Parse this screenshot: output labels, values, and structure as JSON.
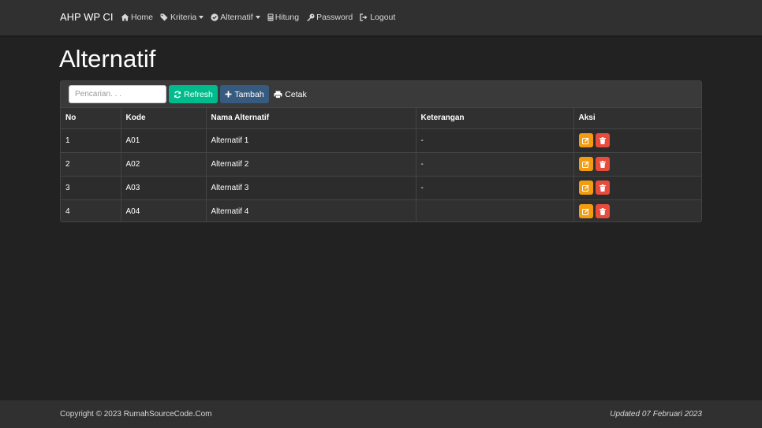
{
  "navbar": {
    "brand": "AHP WP CI",
    "items": [
      {
        "label": "Home",
        "icon": "home-icon",
        "dropdown": false
      },
      {
        "label": "Kriteria",
        "icon": "tags-icon",
        "dropdown": true
      },
      {
        "label": "Alternatif",
        "icon": "check-circle-icon",
        "dropdown": true
      },
      {
        "label": "Hitung",
        "icon": "calculator-icon",
        "dropdown": false
      },
      {
        "label": "Password",
        "icon": "key-icon",
        "dropdown": false
      },
      {
        "label": "Logout",
        "icon": "sign-out-icon",
        "dropdown": false
      }
    ]
  },
  "page": {
    "title": "Alternatif"
  },
  "toolbar": {
    "search_placeholder": "Pencarian. . .",
    "search_value": "",
    "refresh_label": "Refresh",
    "tambah_label": "Tambah",
    "cetak_label": "Cetak"
  },
  "table": {
    "headers": [
      "No",
      "Kode",
      "Nama Alternatif",
      "Keterangan",
      "Aksi"
    ],
    "rows": [
      {
        "no": "1",
        "kode": "A01",
        "nama": "Alternatif 1",
        "keterangan": "-"
      },
      {
        "no": "2",
        "kode": "A02",
        "nama": "Alternatif 2",
        "keterangan": "-"
      },
      {
        "no": "3",
        "kode": "A03",
        "nama": "Alternatif 3",
        "keterangan": "-"
      },
      {
        "no": "4",
        "kode": "A04",
        "nama": "Alternatif 4",
        "keterangan": ""
      }
    ]
  },
  "footer": {
    "copyright": "Copyright © 2023 RumahSourceCode.Com",
    "updated": "Updated 07 Februari 2023"
  },
  "colors": {
    "background": "#222222",
    "navbar": "#303030",
    "success": "#00bc8c",
    "primary": "#375a7f",
    "warning": "#f39c12",
    "danger": "#e74c3c"
  }
}
